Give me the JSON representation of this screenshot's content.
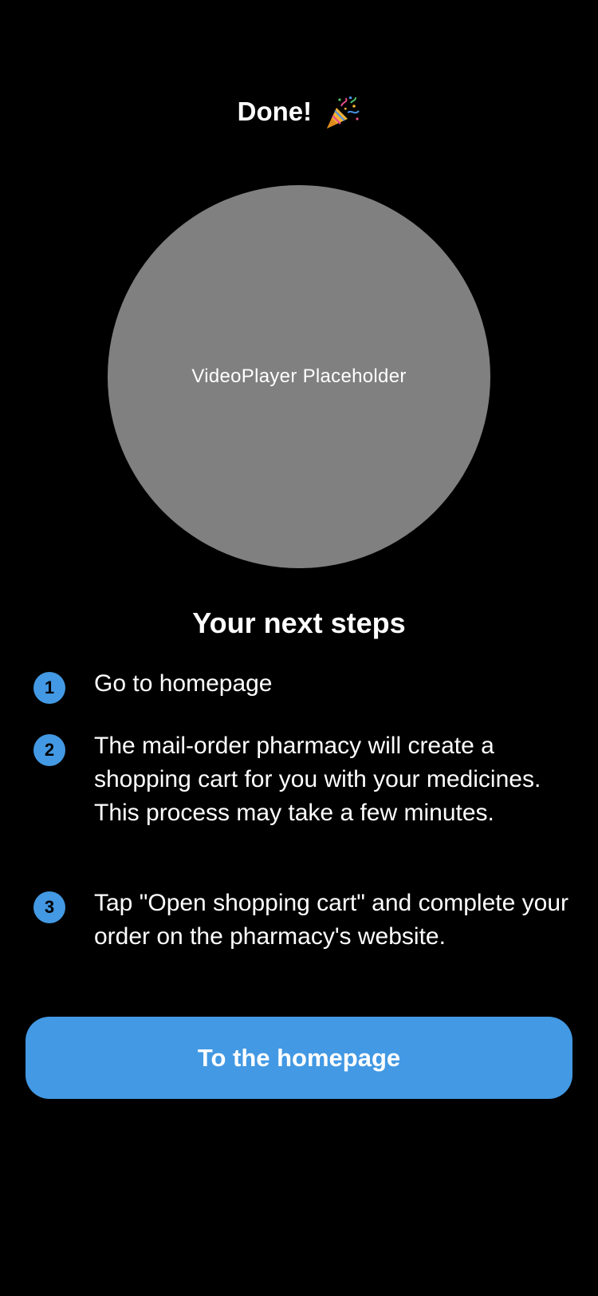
{
  "header": {
    "title": "Done!",
    "title_icon": "party-popper-icon"
  },
  "video": {
    "placeholder_text": "VideoPlayer Placeholder"
  },
  "steps": {
    "heading": "Your next steps",
    "items": [
      {
        "number": "1",
        "text": "Go to homepage"
      },
      {
        "number": "2",
        "text": "The mail-order pharmacy will create a shopping cart for you with your medicines. This process may take a few minutes."
      },
      {
        "number": "3",
        "text": "Tap \"Open shopping cart\" and complete your order on the pharmacy's website."
      }
    ]
  },
  "cta": {
    "label": "To the homepage"
  },
  "colors": {
    "background": "#000000",
    "accent": "#4399E3",
    "video_placeholder": "#808080",
    "text": "#FFFFFF"
  }
}
